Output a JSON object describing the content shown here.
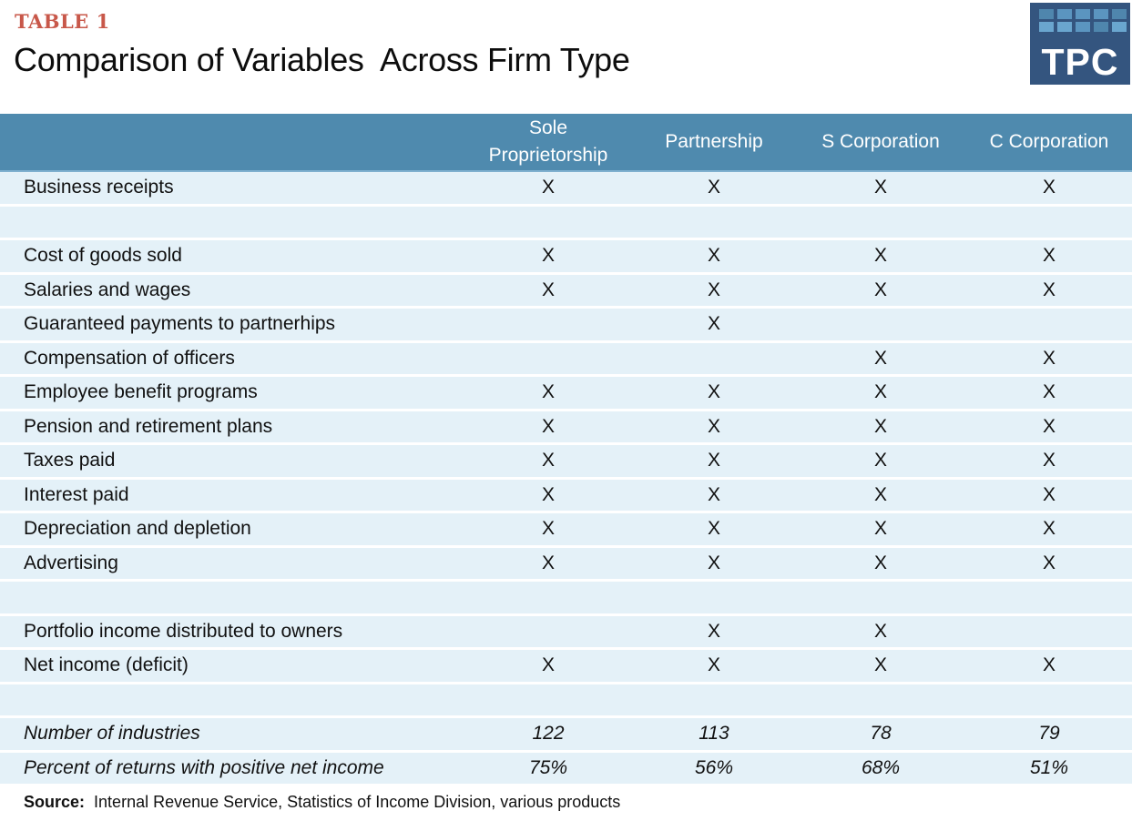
{
  "header": {
    "kicker": "TABLE 1",
    "title": "Comparison of Variables  Across Firm Type",
    "logo_text": "TPC",
    "logo_colors": [
      "#4f86ad",
      "#5b95c0",
      "#5b95c0",
      "#5b95c0",
      "#4f86ad",
      "#6aa6cf",
      "#6aa6cf",
      "#5b95c0",
      "#4f86ad",
      "#6aa6cf"
    ]
  },
  "colors": {
    "kicker": "#c8584a",
    "header_bg": "#4f8aae",
    "row_bg": "#e4f1f8",
    "logo_bg": "#34557f"
  },
  "table": {
    "columns": [
      "Sole\nProprietorship",
      "Partnership",
      "S Corporation",
      "C Corporation"
    ],
    "rows": [
      {
        "label": "Business receipts",
        "cells": [
          "X",
          "X",
          "X",
          "X"
        ]
      },
      {
        "label": "",
        "cells": [
          "",
          "",
          "",
          ""
        ]
      },
      {
        "label": "Cost of goods sold",
        "cells": [
          "X",
          "X",
          "X",
          "X"
        ]
      },
      {
        "label": "Salaries and wages",
        "cells": [
          "X",
          "X",
          "X",
          "X"
        ]
      },
      {
        "label": "Guaranteed payments to partnerhips",
        "cells": [
          "",
          "X",
          "",
          ""
        ]
      },
      {
        "label": "Compensation of officers",
        "cells": [
          "",
          "",
          "X",
          "X"
        ]
      },
      {
        "label": "Employee benefit programs",
        "cells": [
          "X",
          "X",
          "X",
          "X"
        ]
      },
      {
        "label": "Pension and retirement plans",
        "cells": [
          "X",
          "X",
          "X",
          "X"
        ]
      },
      {
        "label": "Taxes paid",
        "cells": [
          "X",
          "X",
          "X",
          "X"
        ]
      },
      {
        "label": "Interest paid",
        "cells": [
          "X",
          "X",
          "X",
          "X"
        ]
      },
      {
        "label": "Depreciation and depletion",
        "cells": [
          "X",
          "X",
          "X",
          "X"
        ]
      },
      {
        "label": "Advertising",
        "cells": [
          "X",
          "X",
          "X",
          "X"
        ]
      },
      {
        "label": "",
        "cells": [
          "",
          "",
          "",
          ""
        ]
      },
      {
        "label": "Portfolio income distributed to owners",
        "cells": [
          "",
          "X",
          "X",
          ""
        ]
      },
      {
        "label": "Net income (deficit)",
        "cells": [
          "X",
          "X",
          "X",
          "X"
        ]
      },
      {
        "label": "",
        "cells": [
          "",
          "",
          "",
          ""
        ]
      },
      {
        "label": "Number of industries",
        "cells": [
          "122",
          "113",
          "78",
          "79"
        ],
        "italic": true
      },
      {
        "label": "Percent of returns with positive net income",
        "cells": [
          "75%",
          "56%",
          "68%",
          "51%"
        ],
        "italic": true
      }
    ]
  },
  "footer": {
    "source_label": "Source:",
    "source_text": "Internal Revenue Service, Statistics of Income Division, various products"
  }
}
